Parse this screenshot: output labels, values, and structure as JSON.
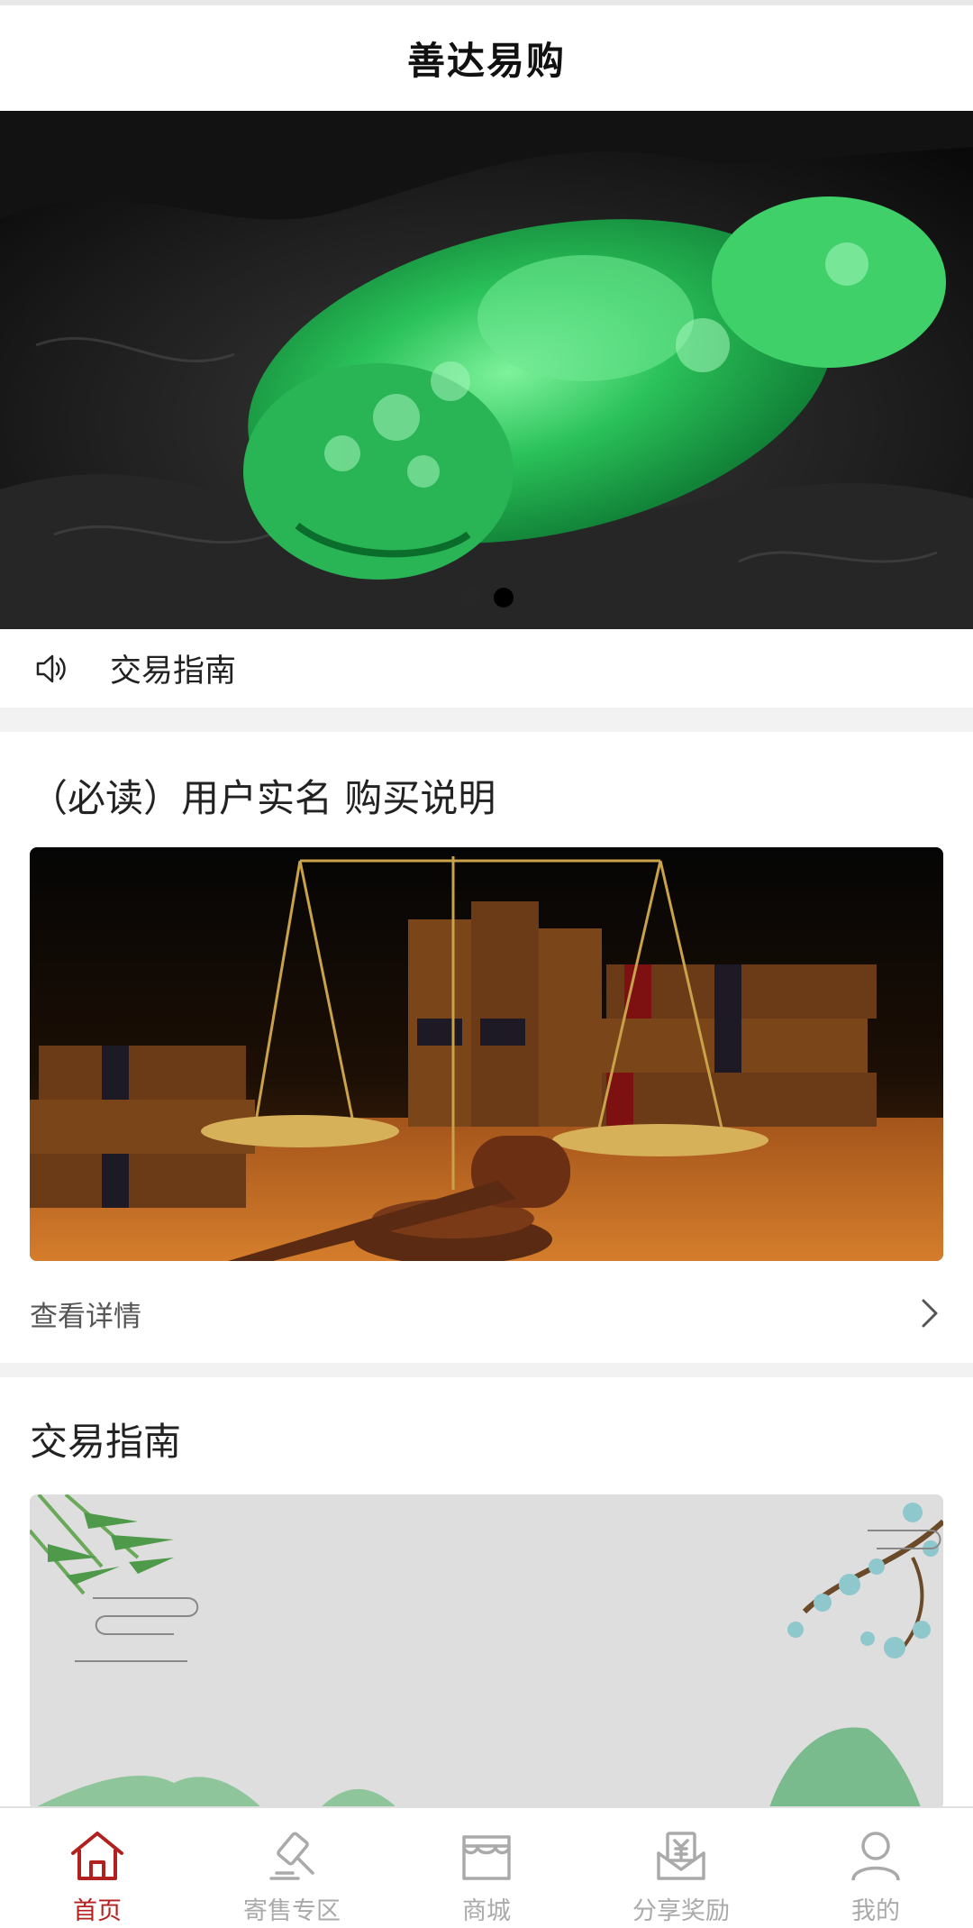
{
  "header": {
    "title": "善达易购"
  },
  "banner": {
    "image_subject": "jade-pixiu-carving",
    "slides": 2,
    "active_slide": 2
  },
  "notice": {
    "icon": "speaker-icon",
    "text": "交易指南"
  },
  "card1": {
    "title": "（必读）用户实名 购买说明",
    "image_subject": "law-scales-gavel-books",
    "detail_label": "查看详情",
    "detail_icon": "chevron-right-icon"
  },
  "card2": {
    "title": "交易指南",
    "image_subject": "bamboo-mountain-ink-painting"
  },
  "tabbar": {
    "active_color": "#b22020",
    "inactive_color": "#aaaaaa",
    "items": [
      {
        "label": "首页",
        "icon": "home-icon",
        "active": true
      },
      {
        "label": "寄售专区",
        "icon": "gavel-icon",
        "active": false
      },
      {
        "label": "商城",
        "icon": "store-icon",
        "active": false
      },
      {
        "label": "分享奖励",
        "icon": "reward-envelope-icon",
        "active": false
      },
      {
        "label": "我的",
        "icon": "user-icon",
        "active": false
      }
    ]
  }
}
